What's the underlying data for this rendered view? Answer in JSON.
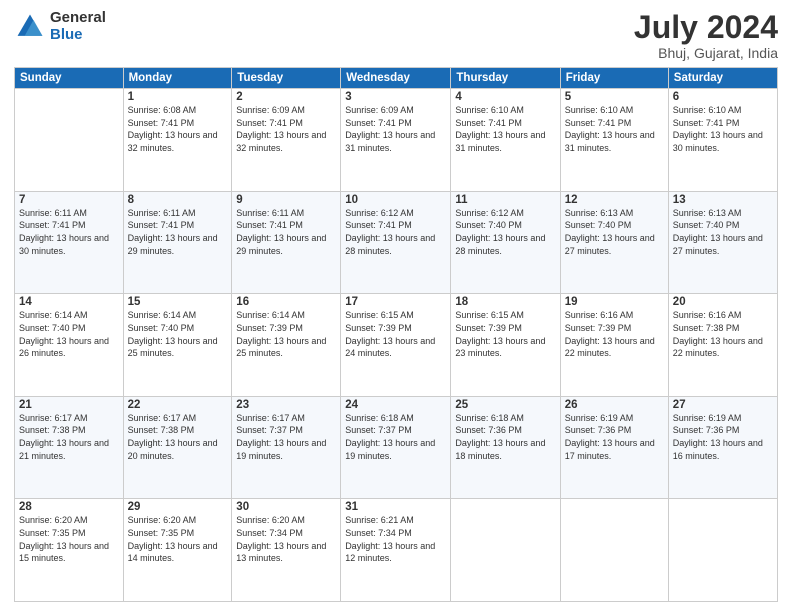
{
  "logo": {
    "general": "General",
    "blue": "Blue"
  },
  "header": {
    "month": "July 2024",
    "location": "Bhuj, Gujarat, India"
  },
  "weekdays": [
    "Sunday",
    "Monday",
    "Tuesday",
    "Wednesday",
    "Thursday",
    "Friday",
    "Saturday"
  ],
  "weeks": [
    [
      {
        "day": null
      },
      {
        "day": 1,
        "sunrise": "Sunrise: 6:08 AM",
        "sunset": "Sunset: 7:41 PM",
        "daylight": "Daylight: 13 hours and 32 minutes."
      },
      {
        "day": 2,
        "sunrise": "Sunrise: 6:09 AM",
        "sunset": "Sunset: 7:41 PM",
        "daylight": "Daylight: 13 hours and 32 minutes."
      },
      {
        "day": 3,
        "sunrise": "Sunrise: 6:09 AM",
        "sunset": "Sunset: 7:41 PM",
        "daylight": "Daylight: 13 hours and 31 minutes."
      },
      {
        "day": 4,
        "sunrise": "Sunrise: 6:10 AM",
        "sunset": "Sunset: 7:41 PM",
        "daylight": "Daylight: 13 hours and 31 minutes."
      },
      {
        "day": 5,
        "sunrise": "Sunrise: 6:10 AM",
        "sunset": "Sunset: 7:41 PM",
        "daylight": "Daylight: 13 hours and 31 minutes."
      },
      {
        "day": 6,
        "sunrise": "Sunrise: 6:10 AM",
        "sunset": "Sunset: 7:41 PM",
        "daylight": "Daylight: 13 hours and 30 minutes."
      }
    ],
    [
      {
        "day": 7,
        "sunrise": "Sunrise: 6:11 AM",
        "sunset": "Sunset: 7:41 PM",
        "daylight": "Daylight: 13 hours and 30 minutes."
      },
      {
        "day": 8,
        "sunrise": "Sunrise: 6:11 AM",
        "sunset": "Sunset: 7:41 PM",
        "daylight": "Daylight: 13 hours and 29 minutes."
      },
      {
        "day": 9,
        "sunrise": "Sunrise: 6:11 AM",
        "sunset": "Sunset: 7:41 PM",
        "daylight": "Daylight: 13 hours and 29 minutes."
      },
      {
        "day": 10,
        "sunrise": "Sunrise: 6:12 AM",
        "sunset": "Sunset: 7:41 PM",
        "daylight": "Daylight: 13 hours and 28 minutes."
      },
      {
        "day": 11,
        "sunrise": "Sunrise: 6:12 AM",
        "sunset": "Sunset: 7:40 PM",
        "daylight": "Daylight: 13 hours and 28 minutes."
      },
      {
        "day": 12,
        "sunrise": "Sunrise: 6:13 AM",
        "sunset": "Sunset: 7:40 PM",
        "daylight": "Daylight: 13 hours and 27 minutes."
      },
      {
        "day": 13,
        "sunrise": "Sunrise: 6:13 AM",
        "sunset": "Sunset: 7:40 PM",
        "daylight": "Daylight: 13 hours and 27 minutes."
      }
    ],
    [
      {
        "day": 14,
        "sunrise": "Sunrise: 6:14 AM",
        "sunset": "Sunset: 7:40 PM",
        "daylight": "Daylight: 13 hours and 26 minutes."
      },
      {
        "day": 15,
        "sunrise": "Sunrise: 6:14 AM",
        "sunset": "Sunset: 7:40 PM",
        "daylight": "Daylight: 13 hours and 25 minutes."
      },
      {
        "day": 16,
        "sunrise": "Sunrise: 6:14 AM",
        "sunset": "Sunset: 7:39 PM",
        "daylight": "Daylight: 13 hours and 25 minutes."
      },
      {
        "day": 17,
        "sunrise": "Sunrise: 6:15 AM",
        "sunset": "Sunset: 7:39 PM",
        "daylight": "Daylight: 13 hours and 24 minutes."
      },
      {
        "day": 18,
        "sunrise": "Sunrise: 6:15 AM",
        "sunset": "Sunset: 7:39 PM",
        "daylight": "Daylight: 13 hours and 23 minutes."
      },
      {
        "day": 19,
        "sunrise": "Sunrise: 6:16 AM",
        "sunset": "Sunset: 7:39 PM",
        "daylight": "Daylight: 13 hours and 22 minutes."
      },
      {
        "day": 20,
        "sunrise": "Sunrise: 6:16 AM",
        "sunset": "Sunset: 7:38 PM",
        "daylight": "Daylight: 13 hours and 22 minutes."
      }
    ],
    [
      {
        "day": 21,
        "sunrise": "Sunrise: 6:17 AM",
        "sunset": "Sunset: 7:38 PM",
        "daylight": "Daylight: 13 hours and 21 minutes."
      },
      {
        "day": 22,
        "sunrise": "Sunrise: 6:17 AM",
        "sunset": "Sunset: 7:38 PM",
        "daylight": "Daylight: 13 hours and 20 minutes."
      },
      {
        "day": 23,
        "sunrise": "Sunrise: 6:17 AM",
        "sunset": "Sunset: 7:37 PM",
        "daylight": "Daylight: 13 hours and 19 minutes."
      },
      {
        "day": 24,
        "sunrise": "Sunrise: 6:18 AM",
        "sunset": "Sunset: 7:37 PM",
        "daylight": "Daylight: 13 hours and 19 minutes."
      },
      {
        "day": 25,
        "sunrise": "Sunrise: 6:18 AM",
        "sunset": "Sunset: 7:36 PM",
        "daylight": "Daylight: 13 hours and 18 minutes."
      },
      {
        "day": 26,
        "sunrise": "Sunrise: 6:19 AM",
        "sunset": "Sunset: 7:36 PM",
        "daylight": "Daylight: 13 hours and 17 minutes."
      },
      {
        "day": 27,
        "sunrise": "Sunrise: 6:19 AM",
        "sunset": "Sunset: 7:36 PM",
        "daylight": "Daylight: 13 hours and 16 minutes."
      }
    ],
    [
      {
        "day": 28,
        "sunrise": "Sunrise: 6:20 AM",
        "sunset": "Sunset: 7:35 PM",
        "daylight": "Daylight: 13 hours and 15 minutes."
      },
      {
        "day": 29,
        "sunrise": "Sunrise: 6:20 AM",
        "sunset": "Sunset: 7:35 PM",
        "daylight": "Daylight: 13 hours and 14 minutes."
      },
      {
        "day": 30,
        "sunrise": "Sunrise: 6:20 AM",
        "sunset": "Sunset: 7:34 PM",
        "daylight": "Daylight: 13 hours and 13 minutes."
      },
      {
        "day": 31,
        "sunrise": "Sunrise: 6:21 AM",
        "sunset": "Sunset: 7:34 PM",
        "daylight": "Daylight: 13 hours and 12 minutes."
      },
      {
        "day": null
      },
      {
        "day": null
      },
      {
        "day": null
      }
    ]
  ]
}
